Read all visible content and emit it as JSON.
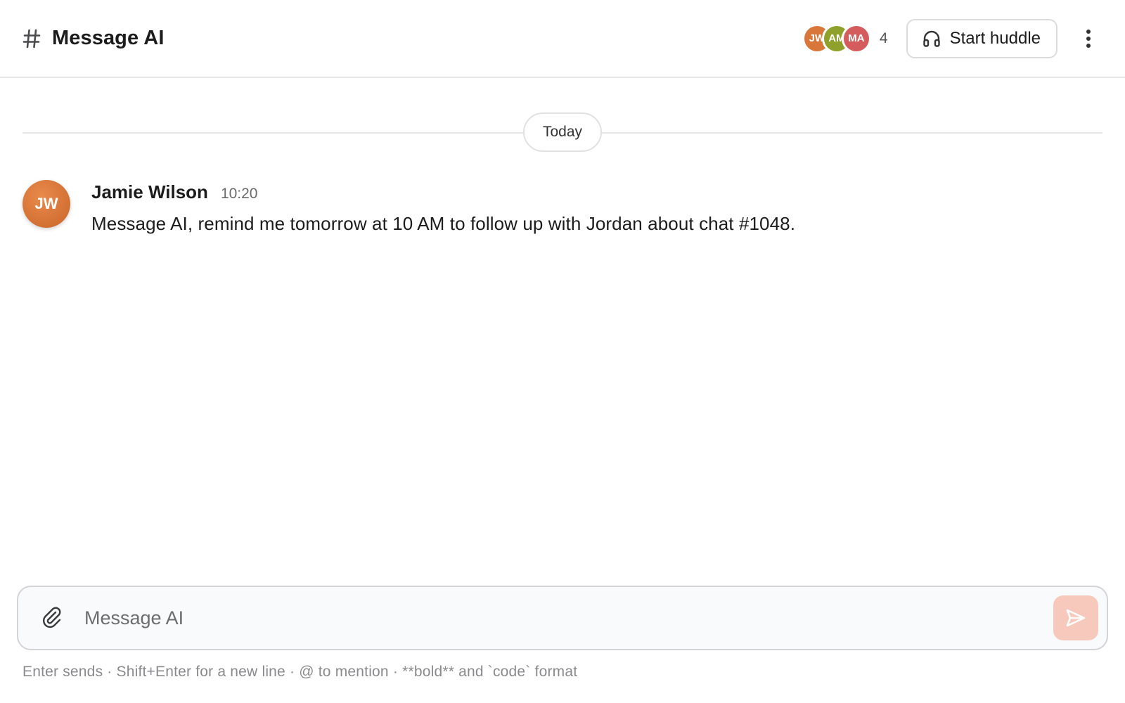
{
  "header": {
    "title": "Message AI",
    "members": [
      {
        "initials": "JW",
        "color": "#d9773a"
      },
      {
        "initials": "AM",
        "color": "#8fa12a"
      },
      {
        "initials": "MA",
        "color": "#d45c5c"
      }
    ],
    "member_count": "4",
    "huddle_label": "Start huddle"
  },
  "divider": {
    "label": "Today"
  },
  "messages": [
    {
      "initials": "JW",
      "author": "Jamie Wilson",
      "time": "10:20",
      "text": "Message AI, remind me tomorrow at 10 AM to follow up with Jordan about chat #1048."
    }
  ],
  "composer": {
    "placeholder": "Message AI",
    "value": "",
    "hint": "Enter sends · Shift+Enter for a new line · @ to mention · **bold** and `code` format"
  },
  "icons": {
    "channel": "hash-icon",
    "huddle": "headphones-icon",
    "more": "kebab-menu-icon",
    "attach": "paperclip-icon",
    "send": "send-icon"
  },
  "colors": {
    "accent": "#e8623f",
    "send_disabled_bg": "#f7c9bd"
  }
}
